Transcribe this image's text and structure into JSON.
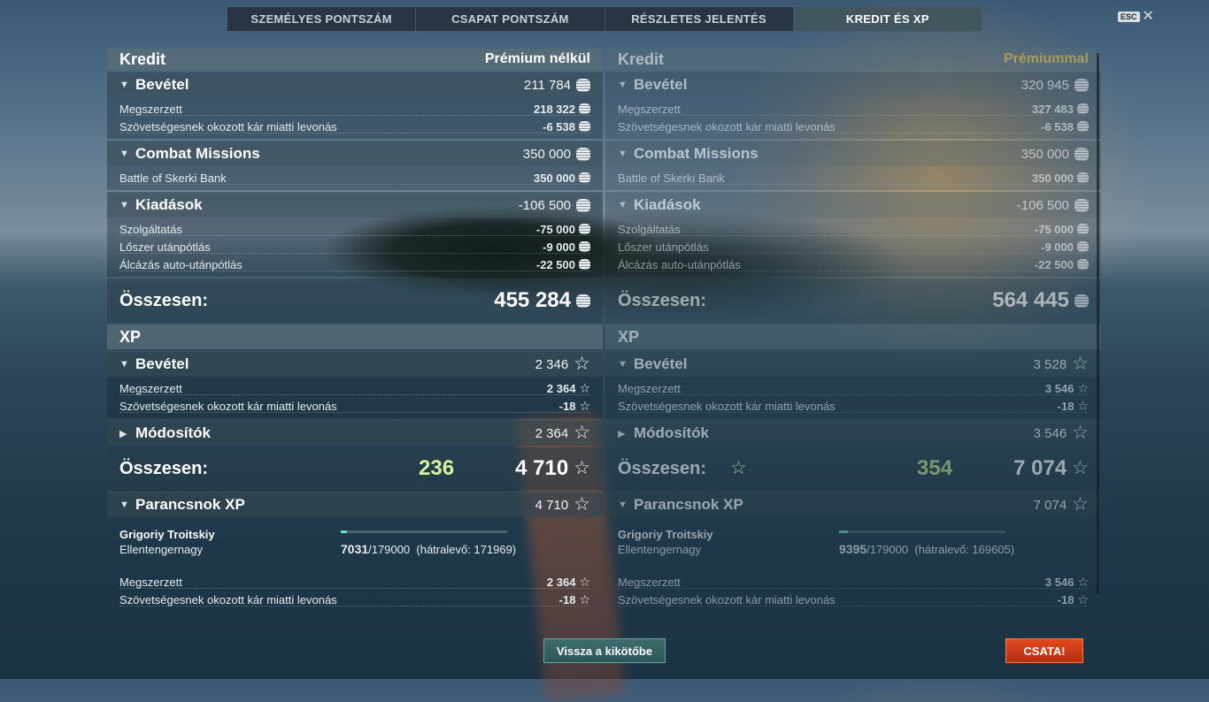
{
  "tabs": [
    {
      "label": "SZEMÉLYES PONTSZÁM"
    },
    {
      "label": "CSAPAT PONTSZÁM"
    },
    {
      "label": "RÉSZLETES JELENTÉS"
    },
    {
      "label": "KREDIT ÉS XP"
    }
  ],
  "esc": {
    "key": "ESC",
    "close": "✕"
  },
  "left": {
    "credit_title": "Kredit",
    "account_label": "Prémium nélkül",
    "income": {
      "label": "Bevétel",
      "value": "211 784",
      "rows": [
        {
          "label": "Megszerzett",
          "value": "218 322"
        },
        {
          "label": "Szövetségesnek okozott kár miatti levonás",
          "value": "-6 538"
        }
      ]
    },
    "missions": {
      "label": "Combat Missions",
      "value": "350 000",
      "rows": [
        {
          "label": "Battle of Skerki Bank",
          "value": "350 000"
        }
      ]
    },
    "expenses": {
      "label": "Kiadások",
      "value": "-106 500",
      "rows": [
        {
          "label": "Szolgáltatás",
          "value": "-75 000"
        },
        {
          "label": "Lőszer utánpótlás",
          "value": "-9 000"
        },
        {
          "label": "Álcázás auto-utánpótlás",
          "value": "-22 500"
        }
      ]
    },
    "credit_total": {
      "label": "Összesen:",
      "value": "455 284"
    },
    "xp_title": "XP",
    "xp_income": {
      "label": "Bevétel",
      "value": "2 346",
      "rows": [
        {
          "label": "Megszerzett",
          "value": "2 364"
        },
        {
          "label": "Szövetségesnek okozott kár miatti levonás",
          "value": "-18"
        }
      ]
    },
    "modifiers": {
      "label": "Módosítók",
      "value": "2 364"
    },
    "xp_total": {
      "label": "Összesen:",
      "bonus": "236",
      "value": "4 710"
    },
    "commander": {
      "label": "Parancsnok XP",
      "value": "4 710",
      "name": "Grigoriy Troitskiy",
      "rank": "Ellentengernagy",
      "current": "7031",
      "max": "/179000",
      "remaining": "(hátralevő: 171969)",
      "progress": 0.039,
      "rows": [
        {
          "label": "Megszerzett",
          "value": "2 364"
        },
        {
          "label": "Szövetségesnek okozott kár miatti levonás",
          "value": "-18"
        }
      ]
    }
  },
  "right": {
    "credit_title": "Kredit",
    "account_label": "Prémiummal",
    "income": {
      "label": "Bevétel",
      "value": "320 945",
      "rows": [
        {
          "label": "Megszerzett",
          "value": "327 483"
        },
        {
          "label": "Szövetségesnek okozott kár miatti levonás",
          "value": "-6 538"
        }
      ]
    },
    "missions": {
      "label": "Combat Missions",
      "value": "350 000",
      "rows": [
        {
          "label": "Battle of Skerki Bank",
          "value": "350 000"
        }
      ]
    },
    "expenses": {
      "label": "Kiadások",
      "value": "-106 500",
      "rows": [
        {
          "label": "Szolgáltatás",
          "value": "-75 000"
        },
        {
          "label": "Lőszer utánpótlás",
          "value": "-9 000"
        },
        {
          "label": "Álcázás auto-utánpótlás",
          "value": "-22 500"
        }
      ]
    },
    "credit_total": {
      "label": "Összesen:",
      "value": "564 445"
    },
    "xp_title": "XP",
    "xp_income": {
      "label": "Bevétel",
      "value": "3 528",
      "rows": [
        {
          "label": "Megszerzett",
          "value": "3 546"
        },
        {
          "label": "Szövetségesnek okozott kár miatti levonás",
          "value": "-18"
        }
      ]
    },
    "modifiers": {
      "label": "Módosítók",
      "value": "3 546"
    },
    "xp_total": {
      "label": "Összesen:",
      "bonus": "354",
      "value": "7 074"
    },
    "commander": {
      "label": "Parancsnok XP",
      "value": "7 074",
      "name": "Grigoriy Troitskiy",
      "rank": "Ellentengernagy",
      "current": "9395",
      "max": "/179000",
      "remaining": "(hátralevő: 169605)",
      "progress": 0.052,
      "rows": [
        {
          "label": "Megszerzett",
          "value": "3 546"
        },
        {
          "label": "Szövetségesnek okozott kár miatti levonás",
          "value": "-18"
        }
      ]
    }
  },
  "buttons": {
    "back": "Vissza a kikötőbe",
    "battle": "CSATA!"
  },
  "colors": {
    "battle": "#e24a20",
    "back": "#2f5a5c",
    "premium": "#f0c040",
    "bonus_xp": "#d8f0a0"
  },
  "icons": {
    "credit": "credit-icon",
    "xp": "star-icon"
  }
}
